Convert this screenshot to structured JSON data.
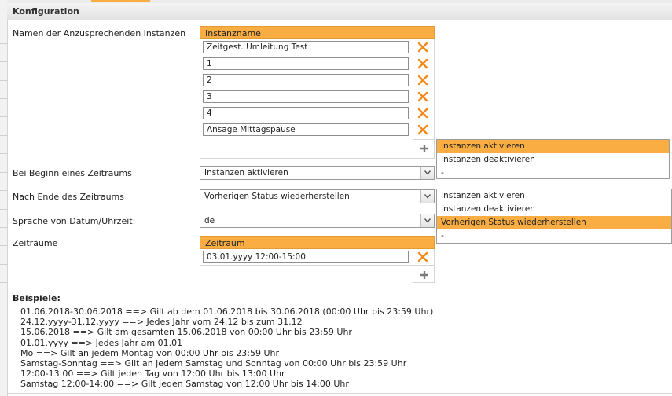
{
  "panel": {
    "title": "Konfiguration"
  },
  "instances": {
    "label": "Namen der Anzusprechenden Instanzen",
    "column_header": "Instanzname",
    "rows": [
      "Zeitgest. Umleitung Test",
      "1",
      "2",
      "3",
      "4",
      "Ansage Mittagspause"
    ]
  },
  "start": {
    "label": "Bei Beginn eines Zeitraums",
    "value": "Instanzen aktivieren",
    "options": [
      "Instanzen aktivieren",
      "Instanzen deaktivieren",
      "-"
    ],
    "selected_index": 0
  },
  "end": {
    "label": "Nach Ende des Zeitraums",
    "value": "Vorherigen Status wiederherstellen",
    "options": [
      "Instanzen aktivieren",
      "Instanzen deaktivieren",
      "Vorherigen Status wiederherstellen",
      "-"
    ],
    "selected_index": 2
  },
  "language": {
    "label": "Sprache von Datum/Uhrzeit:",
    "value": "de"
  },
  "periods": {
    "label": "Zeiträume",
    "column_header": "Zeitraum",
    "rows": [
      "03.01.yyyy 12:00-15:00"
    ]
  },
  "examples": {
    "title": "Beispiele:",
    "lines": [
      "01.06.2018-30.06.2018 ==> Gilt ab dem 01.06.2018 bis 30.06.2018 (00:00 Uhr bis 23:59 Uhr)",
      "24.12.yyyy-31.12.yyyy ==> Jedes Jahr vom 24.12 bis zum 31.12",
      "15.06.2018 ==> Gilt am gesamten 15.06.2018 von 00:00 Uhr bis 23:59 Uhr",
      "01.01.yyyy ==> Jedes Jahr am 01.01",
      "Mo ==> Gilt an jedem Montag von 00:00 Uhr bis 23:59 Uhr",
      "Samstag-Sonntag ==> Gilt an jedem Samstag und Sonntag von 00:00 Uhr bis 23:59 Uhr",
      "12:00-13:00 ==> Gilt jeden Tag von 12:00 Uhr bis 13:00 Uhr",
      "Samstag 12:00-14:00 ==> Gilt jeden Samstag von 12:00 Uhr bis 14:00 Uhr"
    ]
  },
  "icons": {
    "delete": "close-icon",
    "add": "plus-icon",
    "dropdown": "chevron-down-icon"
  },
  "colors": {
    "accent": "#f9ad42",
    "delete_x": "#f08a1a"
  }
}
